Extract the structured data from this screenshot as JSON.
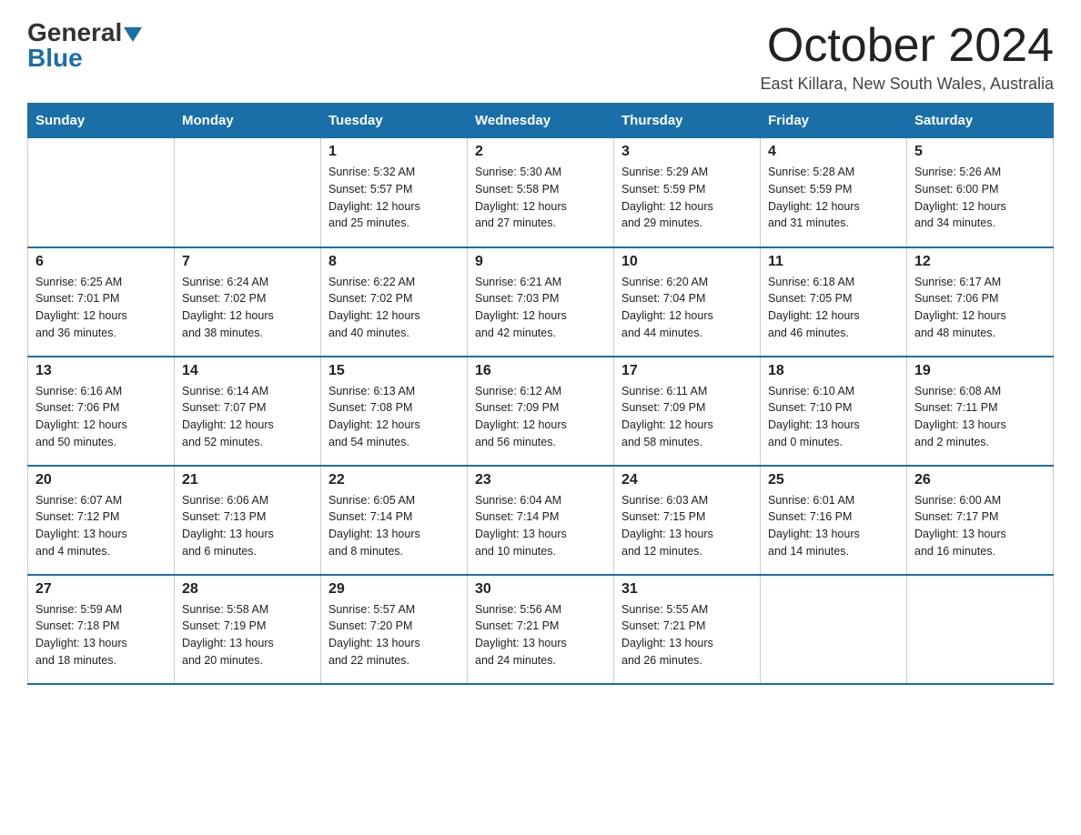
{
  "header": {
    "logo_general": "General",
    "logo_blue": "Blue",
    "month_title": "October 2024",
    "location": "East Killara, New South Wales, Australia"
  },
  "days_of_week": [
    "Sunday",
    "Monday",
    "Tuesday",
    "Wednesday",
    "Thursday",
    "Friday",
    "Saturday"
  ],
  "weeks": [
    [
      {
        "day": "",
        "info": ""
      },
      {
        "day": "",
        "info": ""
      },
      {
        "day": "1",
        "info": "Sunrise: 5:32 AM\nSunset: 5:57 PM\nDaylight: 12 hours\nand 25 minutes."
      },
      {
        "day": "2",
        "info": "Sunrise: 5:30 AM\nSunset: 5:58 PM\nDaylight: 12 hours\nand 27 minutes."
      },
      {
        "day": "3",
        "info": "Sunrise: 5:29 AM\nSunset: 5:59 PM\nDaylight: 12 hours\nand 29 minutes."
      },
      {
        "day": "4",
        "info": "Sunrise: 5:28 AM\nSunset: 5:59 PM\nDaylight: 12 hours\nand 31 minutes."
      },
      {
        "day": "5",
        "info": "Sunrise: 5:26 AM\nSunset: 6:00 PM\nDaylight: 12 hours\nand 34 minutes."
      }
    ],
    [
      {
        "day": "6",
        "info": "Sunrise: 6:25 AM\nSunset: 7:01 PM\nDaylight: 12 hours\nand 36 minutes."
      },
      {
        "day": "7",
        "info": "Sunrise: 6:24 AM\nSunset: 7:02 PM\nDaylight: 12 hours\nand 38 minutes."
      },
      {
        "day": "8",
        "info": "Sunrise: 6:22 AM\nSunset: 7:02 PM\nDaylight: 12 hours\nand 40 minutes."
      },
      {
        "day": "9",
        "info": "Sunrise: 6:21 AM\nSunset: 7:03 PM\nDaylight: 12 hours\nand 42 minutes."
      },
      {
        "day": "10",
        "info": "Sunrise: 6:20 AM\nSunset: 7:04 PM\nDaylight: 12 hours\nand 44 minutes."
      },
      {
        "day": "11",
        "info": "Sunrise: 6:18 AM\nSunset: 7:05 PM\nDaylight: 12 hours\nand 46 minutes."
      },
      {
        "day": "12",
        "info": "Sunrise: 6:17 AM\nSunset: 7:06 PM\nDaylight: 12 hours\nand 48 minutes."
      }
    ],
    [
      {
        "day": "13",
        "info": "Sunrise: 6:16 AM\nSunset: 7:06 PM\nDaylight: 12 hours\nand 50 minutes."
      },
      {
        "day": "14",
        "info": "Sunrise: 6:14 AM\nSunset: 7:07 PM\nDaylight: 12 hours\nand 52 minutes."
      },
      {
        "day": "15",
        "info": "Sunrise: 6:13 AM\nSunset: 7:08 PM\nDaylight: 12 hours\nand 54 minutes."
      },
      {
        "day": "16",
        "info": "Sunrise: 6:12 AM\nSunset: 7:09 PM\nDaylight: 12 hours\nand 56 minutes."
      },
      {
        "day": "17",
        "info": "Sunrise: 6:11 AM\nSunset: 7:09 PM\nDaylight: 12 hours\nand 58 minutes."
      },
      {
        "day": "18",
        "info": "Sunrise: 6:10 AM\nSunset: 7:10 PM\nDaylight: 13 hours\nand 0 minutes."
      },
      {
        "day": "19",
        "info": "Sunrise: 6:08 AM\nSunset: 7:11 PM\nDaylight: 13 hours\nand 2 minutes."
      }
    ],
    [
      {
        "day": "20",
        "info": "Sunrise: 6:07 AM\nSunset: 7:12 PM\nDaylight: 13 hours\nand 4 minutes."
      },
      {
        "day": "21",
        "info": "Sunrise: 6:06 AM\nSunset: 7:13 PM\nDaylight: 13 hours\nand 6 minutes."
      },
      {
        "day": "22",
        "info": "Sunrise: 6:05 AM\nSunset: 7:14 PM\nDaylight: 13 hours\nand 8 minutes."
      },
      {
        "day": "23",
        "info": "Sunrise: 6:04 AM\nSunset: 7:14 PM\nDaylight: 13 hours\nand 10 minutes."
      },
      {
        "day": "24",
        "info": "Sunrise: 6:03 AM\nSunset: 7:15 PM\nDaylight: 13 hours\nand 12 minutes."
      },
      {
        "day": "25",
        "info": "Sunrise: 6:01 AM\nSunset: 7:16 PM\nDaylight: 13 hours\nand 14 minutes."
      },
      {
        "day": "26",
        "info": "Sunrise: 6:00 AM\nSunset: 7:17 PM\nDaylight: 13 hours\nand 16 minutes."
      }
    ],
    [
      {
        "day": "27",
        "info": "Sunrise: 5:59 AM\nSunset: 7:18 PM\nDaylight: 13 hours\nand 18 minutes."
      },
      {
        "day": "28",
        "info": "Sunrise: 5:58 AM\nSunset: 7:19 PM\nDaylight: 13 hours\nand 20 minutes."
      },
      {
        "day": "29",
        "info": "Sunrise: 5:57 AM\nSunset: 7:20 PM\nDaylight: 13 hours\nand 22 minutes."
      },
      {
        "day": "30",
        "info": "Sunrise: 5:56 AM\nSunset: 7:21 PM\nDaylight: 13 hours\nand 24 minutes."
      },
      {
        "day": "31",
        "info": "Sunrise: 5:55 AM\nSunset: 7:21 PM\nDaylight: 13 hours\nand 26 minutes."
      },
      {
        "day": "",
        "info": ""
      },
      {
        "day": "",
        "info": ""
      }
    ]
  ]
}
